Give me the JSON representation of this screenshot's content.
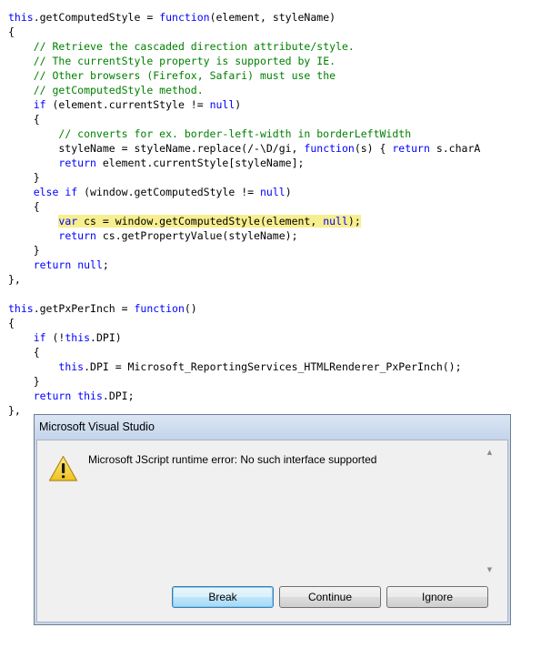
{
  "code": {
    "lines": [
      [
        {
          "t": "this",
          "c": "kw"
        },
        {
          "t": ".getComputedStyle = "
        },
        {
          "t": "function",
          "c": "kw"
        },
        {
          "t": "(element, styleName)"
        }
      ],
      [
        {
          "t": "{"
        }
      ],
      [
        {
          "t": "    "
        },
        {
          "t": "// Retrieve the cascaded direction attribute/style.",
          "c": "cm"
        }
      ],
      [
        {
          "t": "    "
        },
        {
          "t": "// The currentStyle property is supported by IE.",
          "c": "cm"
        }
      ],
      [
        {
          "t": "    "
        },
        {
          "t": "// Other browsers (Firefox, Safari) must use the",
          "c": "cm"
        }
      ],
      [
        {
          "t": "    "
        },
        {
          "t": "// getComputedStyle method.",
          "c": "cm"
        }
      ],
      [
        {
          "t": "    "
        },
        {
          "t": "if",
          "c": "kw"
        },
        {
          "t": " (element.currentStyle != "
        },
        {
          "t": "null",
          "c": "kw"
        },
        {
          "t": ")"
        }
      ],
      [
        {
          "t": "    {"
        }
      ],
      [
        {
          "t": "        "
        },
        {
          "t": "// converts for ex. border-left-width in borderLeftWidth",
          "c": "cm"
        }
      ],
      [
        {
          "t": "        styleName = styleName.replace(/-\\D/gi, "
        },
        {
          "t": "function",
          "c": "kw"
        },
        {
          "t": "(s) { "
        },
        {
          "t": "return",
          "c": "kw"
        },
        {
          "t": " s.charA"
        }
      ],
      [
        {
          "t": "        "
        },
        {
          "t": "return",
          "c": "kw"
        },
        {
          "t": " element.currentStyle[styleName];"
        }
      ],
      [
        {
          "t": "    }"
        }
      ],
      [
        {
          "t": "    "
        },
        {
          "t": "else",
          "c": "kw"
        },
        {
          "t": " "
        },
        {
          "t": "if",
          "c": "kw"
        },
        {
          "t": " (window.getComputedStyle != "
        },
        {
          "t": "null",
          "c": "kw"
        },
        {
          "t": ")"
        }
      ],
      [
        {
          "t": "    {"
        }
      ],
      [
        {
          "t": "        "
        },
        {
          "t": "var",
          "c": "kw hl"
        },
        {
          "t": " cs = window.getComputedStyle(element, ",
          "c": "hl"
        },
        {
          "t": "null",
          "c": "kw hl"
        },
        {
          "t": ");",
          "c": "hl"
        }
      ],
      [
        {
          "t": "        "
        },
        {
          "t": "return",
          "c": "kw"
        },
        {
          "t": " cs.getPropertyValue(styleName);"
        }
      ],
      [
        {
          "t": "    }"
        }
      ],
      [
        {
          "t": "    "
        },
        {
          "t": "return",
          "c": "kw"
        },
        {
          "t": " "
        },
        {
          "t": "null",
          "c": "kw"
        },
        {
          "t": ";"
        }
      ],
      [
        {
          "t": "},"
        }
      ],
      [
        {
          "t": ""
        }
      ],
      [
        {
          "t": "this",
          "c": "kw"
        },
        {
          "t": ".getPxPerInch = "
        },
        {
          "t": "function",
          "c": "kw"
        },
        {
          "t": "()"
        }
      ],
      [
        {
          "t": "{"
        }
      ],
      [
        {
          "t": "    "
        },
        {
          "t": "if",
          "c": "kw"
        },
        {
          "t": " (!"
        },
        {
          "t": "this",
          "c": "kw"
        },
        {
          "t": ".DPI)"
        }
      ],
      [
        {
          "t": "    {"
        }
      ],
      [
        {
          "t": "        "
        },
        {
          "t": "this",
          "c": "kw"
        },
        {
          "t": ".DPI = Microsoft_ReportingServices_HTMLRenderer_PxPerInch();"
        }
      ],
      [
        {
          "t": "    }"
        }
      ],
      [
        {
          "t": "    "
        },
        {
          "t": "return",
          "c": "kw"
        },
        {
          "t": " "
        },
        {
          "t": "this",
          "c": "kw"
        },
        {
          "t": ".DPI;"
        }
      ],
      [
        {
          "t": "},"
        }
      ]
    ]
  },
  "dialog": {
    "title": "Microsoft Visual Studio",
    "message": "Microsoft JScript runtime error: No such interface supported",
    "icon": "warning-icon",
    "buttons": {
      "break": "Break",
      "continue": "Continue",
      "ignore": "Ignore"
    }
  },
  "colors": {
    "keyword": "#0000ff",
    "comment": "#008000",
    "highlight": "#f7ee8f"
  }
}
